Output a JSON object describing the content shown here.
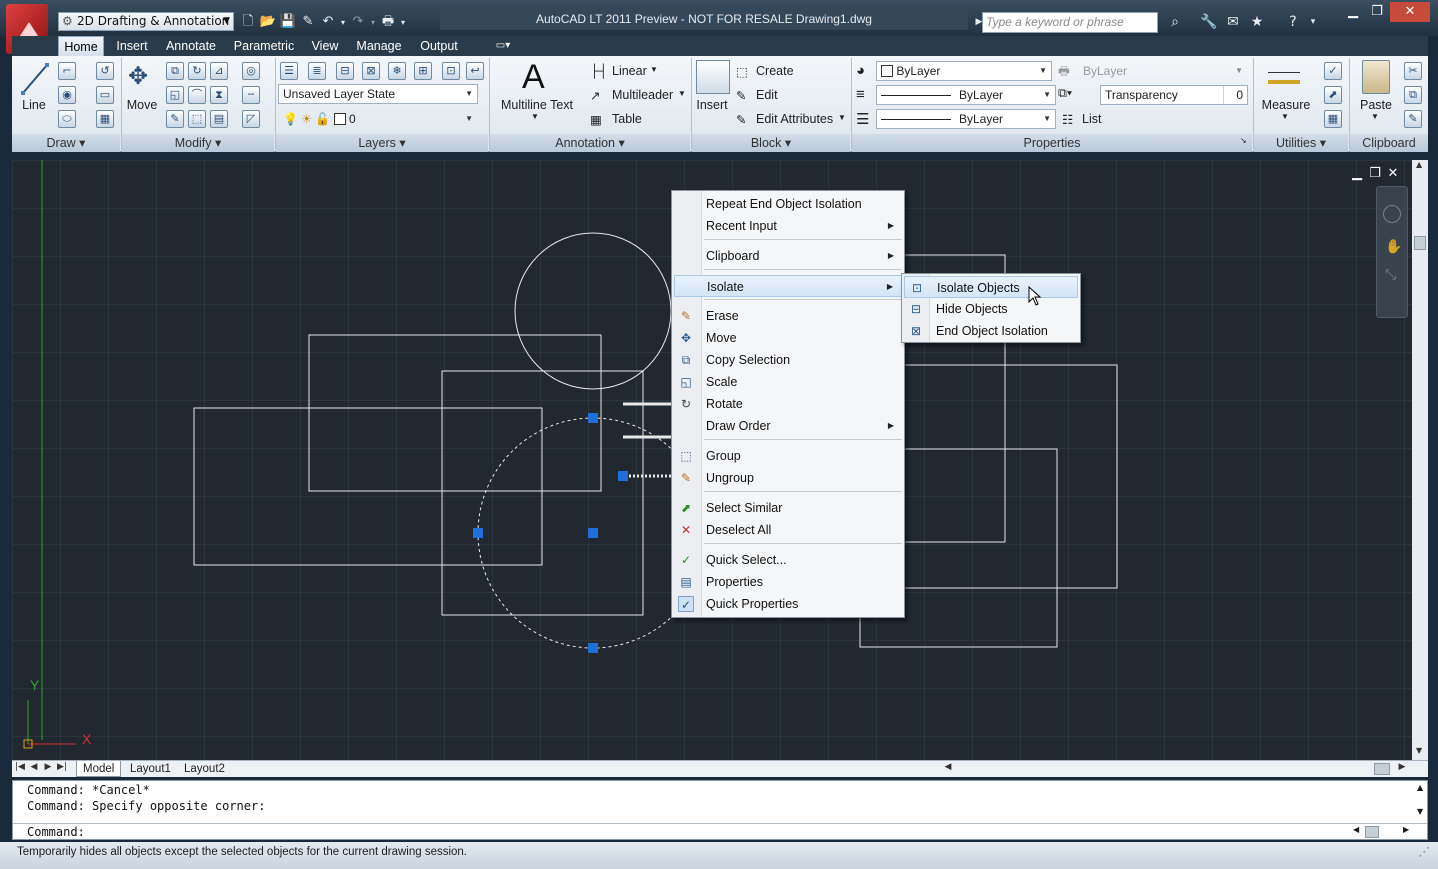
{
  "window": {
    "title": "AutoCAD LT 2011 Preview - NOT FOR RESALE      Drawing1.dwg",
    "workspace": "2D Drafting & Annotation",
    "search_placeholder": "Type a keyword or phrase"
  },
  "ribbon_tabs": [
    "Home",
    "Insert",
    "Annotate",
    "Parametric",
    "View",
    "Manage",
    "Output"
  ],
  "ribbon": {
    "draw": {
      "title": "Draw",
      "line": "Line"
    },
    "modify": {
      "title": "Modify",
      "move": "Move"
    },
    "layers": {
      "title": "Layers",
      "layer_state": "Unsaved Layer State",
      "current_layer": "0"
    },
    "annotation": {
      "title": "Annotation",
      "multiline_text": "Multiline Text",
      "linear": "Linear",
      "multileader": "Multileader",
      "table": "Table"
    },
    "block": {
      "title": "Block",
      "insert": "Insert",
      "create": "Create",
      "edit": "Edit",
      "edit_attributes": "Edit Attributes"
    },
    "properties": {
      "title": "Properties",
      "color": "ByLayer",
      "linetype": "ByLayer",
      "lineweight": "ByLayer",
      "plotstyle": "ByLayer",
      "transparency_label": "Transparency",
      "transparency_value": "0",
      "list": "List"
    },
    "utilities": {
      "title": "Utilities",
      "measure": "Measure"
    },
    "clipboard": {
      "title": "Clipboard",
      "paste": "Paste"
    }
  },
  "layout_tabs": [
    "Model",
    "Layout1",
    "Layout2"
  ],
  "command": {
    "history": [
      "Command: *Cancel*",
      "Command: Specify opposite corner:"
    ],
    "prompt": "Command:"
  },
  "status_text": "Temporarily hides all objects except the selected objects for the current drawing session.",
  "context_menu": {
    "items": [
      {
        "label": "Repeat End Object Isolation"
      },
      {
        "label": "Recent Input"
      },
      {
        "label": "Clipboard"
      },
      {
        "label": "Isolate"
      },
      {
        "label": "Erase"
      },
      {
        "label": "Move"
      },
      {
        "label": "Copy Selection"
      },
      {
        "label": "Scale"
      },
      {
        "label": "Rotate"
      },
      {
        "label": "Draw Order"
      },
      {
        "label": "Group"
      },
      {
        "label": "Ungroup"
      },
      {
        "label": "Select Similar"
      },
      {
        "label": "Deselect All"
      },
      {
        "label": "Quick Select..."
      },
      {
        "label": "Properties"
      },
      {
        "label": "Quick Properties"
      }
    ]
  },
  "isolate_submenu": {
    "items": [
      {
        "label": "Isolate Objects"
      },
      {
        "label": "Hide Objects"
      },
      {
        "label": "End Object Isolation"
      }
    ]
  },
  "colors": {
    "grip": "#1e6fd9",
    "canvas": "#212830",
    "ucs_x": "#d63030",
    "ucs_y": "#2fa52f"
  }
}
